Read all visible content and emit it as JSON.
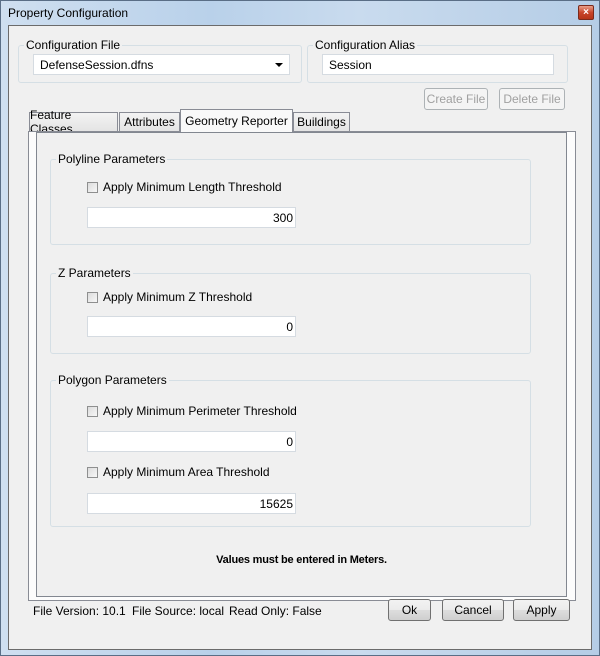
{
  "window": {
    "title": "Property Configuration",
    "close_icon": "close-x-icon"
  },
  "config_file": {
    "label": "Configuration File",
    "selected": "DefenseSession.dfns"
  },
  "config_alias": {
    "label": "Configuration Alias",
    "value": "Session"
  },
  "file_buttons": {
    "create": "Create File",
    "delete": "Delete File"
  },
  "tabs": [
    {
      "label": "Feature Classes",
      "active": false
    },
    {
      "label": "Attributes",
      "active": false
    },
    {
      "label": "Geometry Reporter",
      "active": true
    },
    {
      "label": "Buildings",
      "active": false
    }
  ],
  "polyline": {
    "title": "Polyline Parameters",
    "checkbox_label": "Apply Minimum Length Threshold",
    "checked": false,
    "value": "300"
  },
  "z": {
    "title": "Z Parameters",
    "checkbox_label": "Apply Minimum Z Threshold",
    "checked": false,
    "value": "0"
  },
  "polygon": {
    "title": "Polygon Parameters",
    "perimeter_label": "Apply Minimum Perimeter Threshold",
    "perimeter_checked": false,
    "perimeter_value": "0",
    "area_label": "Apply Minimum Area Threshold",
    "area_checked": false,
    "area_value": "15625"
  },
  "note": "Values must be entered in Meters.",
  "status": {
    "file_version": "File Version: 10.1",
    "file_source": "File Source: local",
    "read_only": "Read Only: False"
  },
  "dialog_buttons": {
    "ok": "Ok",
    "cancel": "Cancel",
    "apply": "Apply"
  }
}
